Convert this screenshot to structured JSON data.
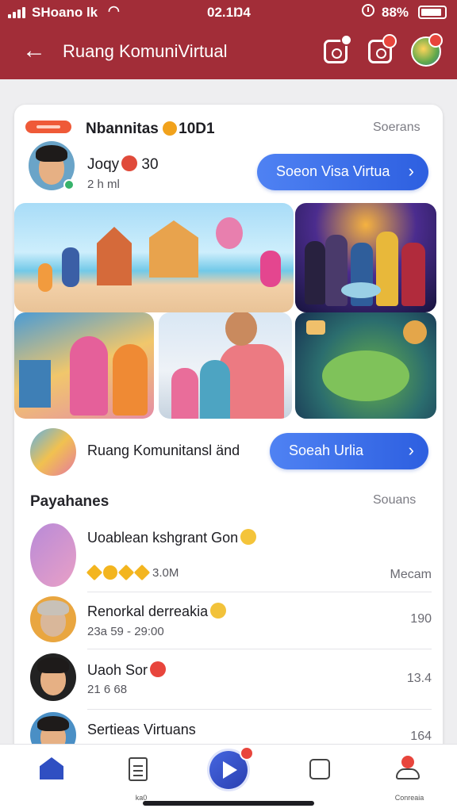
{
  "status_bar": {
    "carrier": "SHoanо lk",
    "time": "02.1Ŋ4",
    "battery": "88%"
  },
  "header": {
    "title": "Ruang KomuniVirtual",
    "back_icon": "arrow-left-icon",
    "icons": [
      "calendar-icon",
      "camera-icon",
      "avatar"
    ]
  },
  "featured": {
    "title": "Nbannitas",
    "title_suffix": "10D1",
    "see_all": "Soerans",
    "user": {
      "name": "Joqy",
      "name_suffix": "30",
      "subtitle": "2 h ml"
    },
    "cta_label": "Soeon Visa Virtua"
  },
  "gallery": {
    "tiles": [
      "village-illustration",
      "community-photo",
      "pink-partial",
      "family-illustration",
      "family-photo",
      "game-world"
    ]
  },
  "community_row": {
    "text": "Ruang Komunitansl änd",
    "cta_label": "Soeah Urlia"
  },
  "section": {
    "title": "Payahanes",
    "see_all": "Souans"
  },
  "list": [
    {
      "name": "Uoablean kshgrant Gon",
      "rating_text": "3.0M",
      "value": "Mecam"
    },
    {
      "name": "Renorkal derreakia",
      "sub": "23a 59 - 29:00",
      "value": "190"
    },
    {
      "name": "Uaoh Sor",
      "sub": "21 6 68",
      "value": "13.4"
    },
    {
      "name": "Sertieas Virtuans",
      "sub": "",
      "value": "164"
    }
  ],
  "bottom_nav": {
    "home_label": "",
    "doc_label": "ka0",
    "profile_label": "Conreaia"
  },
  "colors": {
    "header": "#a22d38",
    "accent": "#2d5fe0",
    "badge": "#e8453c"
  }
}
